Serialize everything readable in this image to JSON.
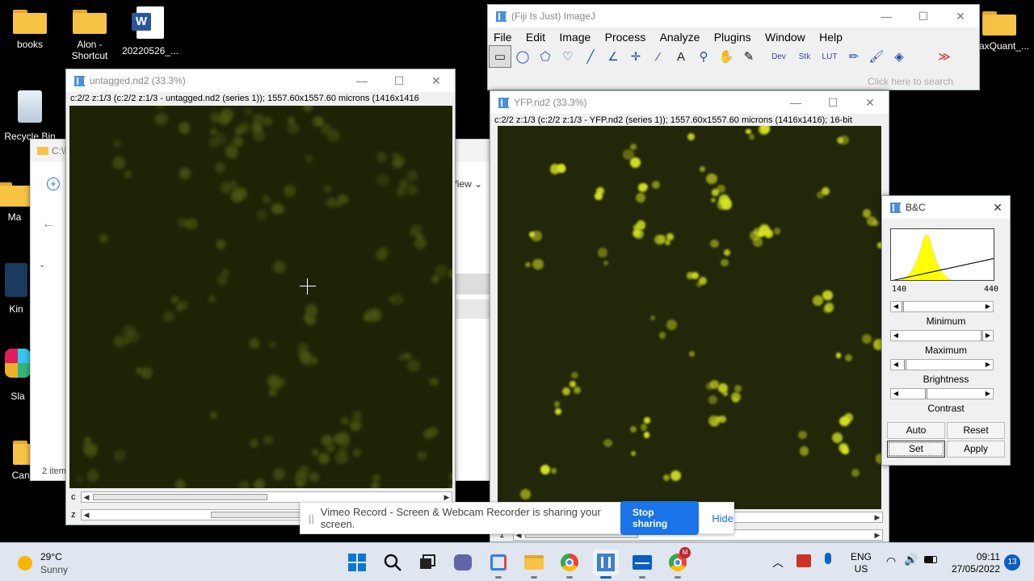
{
  "desktop": {
    "icons": [
      {
        "label": "books"
      },
      {
        "label": "Alon - Shortcut"
      },
      {
        "label": "20220526_..."
      },
      {
        "label": "Recycle Bin"
      },
      {
        "label": "Ma"
      },
      {
        "label": "Kin"
      },
      {
        "label": "Sla"
      },
      {
        "label": "Candida"
      },
      {
        "label": "axQuant_..."
      }
    ]
  },
  "explorer": {
    "path": "C:\\U",
    "view_label": "View",
    "count": "2 item"
  },
  "untagged": {
    "title": "untagged.nd2 (33.3%)",
    "info": "c:2/2 z:1/3 (c:2/2 z:1/3 - untagged.nd2 (series 1)); 1557.60x1557.60 microns (1416x1416",
    "slider_c_label": "c",
    "slider_z_label": "z"
  },
  "fiji": {
    "title": "(Fiji Is Just) ImageJ",
    "menu": [
      "File",
      "Edit",
      "Image",
      "Process",
      "Analyze",
      "Plugins",
      "Window",
      "Help"
    ],
    "tools": [
      "rectangle-tool",
      "oval-tool",
      "polygon-tool",
      "freehand-tool",
      "line-tool",
      "angle-tool",
      "point-tool",
      "wand-tool",
      "text-tool",
      "magnifier-tool",
      "hand-tool",
      "dropper-tool"
    ],
    "tool_dev": "Dev",
    "tool_stk": "Stk",
    "tool_lut": "LUT",
    "search_placeholder": "Click here to search"
  },
  "yfp": {
    "title": "YFP.nd2 (33.3%)",
    "info": "c:2/2 z:1/3 (c:2/2 z:1/3 - YFP.nd2 (series 1)); 1557.60x1557.60 microns (1416x1416); 16-bit",
    "slider_z_label": "z"
  },
  "bc": {
    "title": "B&C",
    "hist_min": "140",
    "hist_max": "440",
    "minimum_label": "Minimum",
    "maximum_label": "Maximum",
    "brightness_label": "Brightness",
    "contrast_label": "Contrast",
    "auto": "Auto",
    "reset": "Reset",
    "set": "Set",
    "apply": "Apply",
    "minimum_level": 0.02,
    "maximum_level": 0.98,
    "brightness_level": 0.05,
    "contrast_level": 0.3
  },
  "sharing": {
    "message": "Vimeo Record - Screen & Webcam Recorder is sharing your screen.",
    "stop": "Stop sharing",
    "hide": "Hide"
  },
  "taskbar": {
    "weather_temp": "29°C",
    "weather_desc": "Sunny",
    "lang1": "ENG",
    "lang2": "US",
    "time": "09:11",
    "date": "27/05/2022",
    "notif_count": "13",
    "apps": [
      "start-icon",
      "search-icon",
      "task-view-icon",
      "chat-icon",
      "snipping-icon",
      "file-explorer-icon",
      "chrome-icon",
      "fiji-icon",
      "mail-icon",
      "chrome-profile-icon"
    ]
  },
  "colors": {
    "accent": "#1a73e8",
    "cell": "#d5e520",
    "canvas": "#1e2306"
  }
}
